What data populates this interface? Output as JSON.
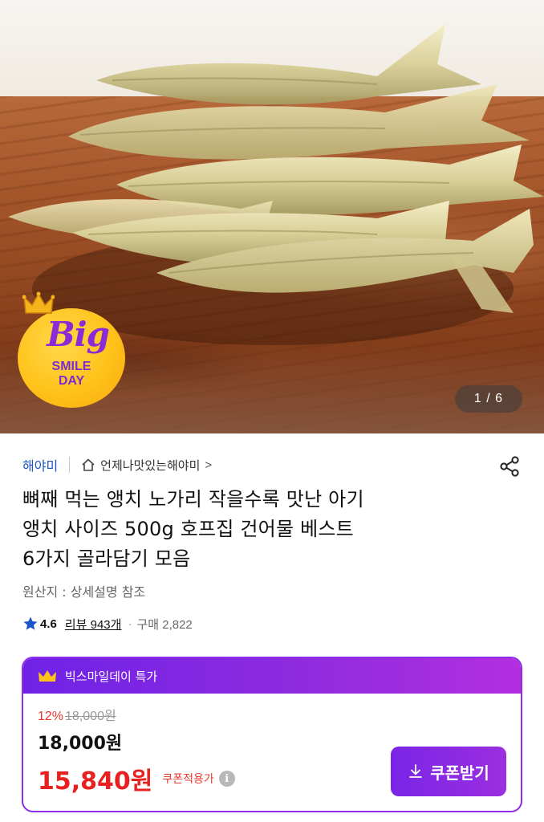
{
  "hero": {
    "pager": "1 / 6",
    "badge": {
      "big": "Big",
      "smile": "SMILE",
      "day": "DAY"
    }
  },
  "seller": {
    "brand": "해야미",
    "store": "언제나맛있는해야미",
    "chevron": ">"
  },
  "product": {
    "title_lines": [
      "뼈째 먹는 앵치 노가리 작을수록 맛난 아기",
      "앵치 사이즈 500g 호프집 건어물 베스트",
      "6가지 골라담기 모음"
    ],
    "origin": "원산지 : 상세설명 참조",
    "rating": "4.6",
    "reviews": "리뷰 943개",
    "separator": "·",
    "purchases": "구매 2,822"
  },
  "deal": {
    "label": "빅스마일데이 특가",
    "discount_rate": "12%",
    "original_price": "18,000원",
    "sale_price": "18,000원",
    "coupon_price": "15,840원",
    "coupon_note": "쿠폰적용가",
    "coupon_button": "쿠폰받기"
  },
  "colors": {
    "accent_purple": "#8f2bea",
    "price_red": "#e8201f",
    "link_blue": "#1a55c8"
  }
}
